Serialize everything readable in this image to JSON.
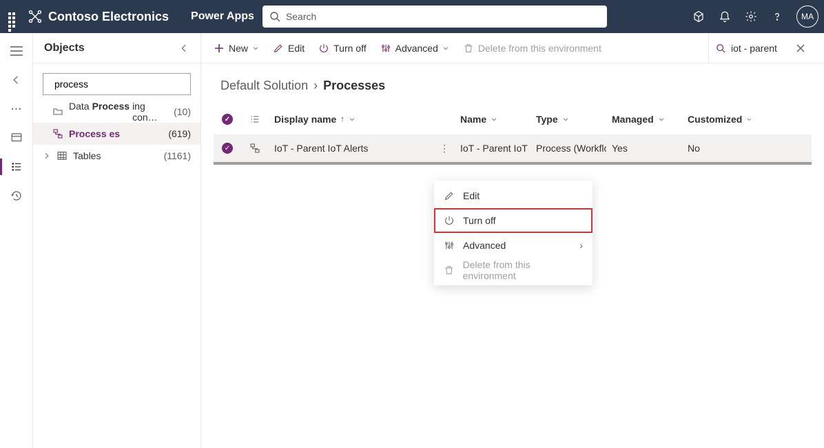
{
  "topbar": {
    "org": "Contoso Electronics",
    "app": "Power Apps",
    "search_placeholder": "Search",
    "avatar": "MA"
  },
  "sidebar": {
    "title": "Objects",
    "search_value": "process",
    "items": [
      {
        "icon": "folder",
        "label_pre": "Data ",
        "label_hl": "Process",
        "label_post": "ing con…",
        "count": "(10)",
        "selected": false,
        "indent": 1
      },
      {
        "icon": "process",
        "label_pre": "",
        "label_hl": "Process",
        "label_post": "es",
        "count": "(619)",
        "selected": true,
        "indent": 1,
        "purple": true
      },
      {
        "icon": "table",
        "label_pre": "Tables",
        "label_hl": "",
        "label_post": "",
        "count": "(1161)",
        "selected": false,
        "indent": 0,
        "expand": true
      }
    ]
  },
  "cmdbar": {
    "new": "New",
    "edit": "Edit",
    "turn_off": "Turn off",
    "advanced": "Advanced",
    "delete": "Delete from this environment",
    "filter_value": "iot - parent"
  },
  "breadcrumb": {
    "root": "Default Solution",
    "leaf": "Processes"
  },
  "table": {
    "headers": {
      "display_name": "Display name",
      "name": "Name",
      "type": "Type",
      "managed": "Managed",
      "customized": "Customized"
    },
    "rows": [
      {
        "display_name": "IoT - Parent IoT Alerts",
        "name": "IoT - Parent IoT …",
        "type": "Process (Workflo…",
        "managed": "Yes",
        "customized": "No",
        "selected": true
      }
    ]
  },
  "context_menu": {
    "edit": "Edit",
    "turn_off": "Turn off",
    "advanced": "Advanced",
    "delete": "Delete from this environment"
  }
}
